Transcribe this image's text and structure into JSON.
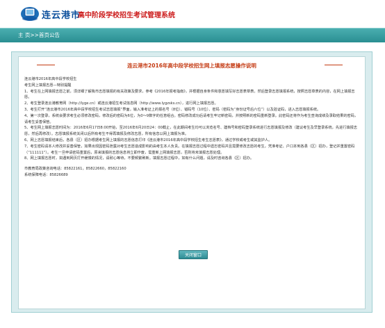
{
  "header": {
    "site_name": "连云港市",
    "system_name": "高中阶段学校招生考试管理系统"
  },
  "breadcrumb": "主 页>>首页公告",
  "notice": {
    "title": "连云港市2016年高中段学校招生网上填报志愿操作说明",
    "intro": [
      "连云港市2016年高中段学校招生",
      "考生网上填报志愿—特别提醒"
    ],
    "items": [
      "1、考生在上网填报志愿之前，须详细了解我市志愿填报的有关政策及要求，参考《2016年报考指南》，并根据自身条件和意愿填写好志愿表草表。然后登录志愿填报系统，按照志愿草表的内容，在网上填报志愿。",
      "2、考生登录连云港教育网（http://lyge.cn）或连云港招生考试信息网（http://www.lygzsks.cn），进行网上填报志愿。",
      "3、考生打开“连云港市2016年高中段学校招生考试志愿填报”界面，输入准考证上的报名号（8位）、错码号（10位）、密码（密码为“身份证号后六位”）以及验证码，进入志愿填报系统。",
      "4、第一次登录，系统会要求考生必须修改密码，修改后的密码为6位，为0～9数字的任意组合。密码修改成功后请考生牢记新密码，并按照新的密码重新登录。此密码还将作为考生查询成绩及录取结果的密码，请考生妥善保管。",
      "5、考生网上填报志愿时间为：2016年6月17日8:00开始，至2016年6月20日24：00截止，在此期间考生均可以浏览名号、建档号和密码登录系统进行志愿填报及修改（建议考生及早登录系统，先进行填报志愿，然后再修改）。志愿填报系统关闭以后所有考生不得再填报及修改志愿，所有信息以网上填报为准。",
      "6、网上志愿填报结束后，各县（区）招办根据考生网上填报的志愿信息打印《连云港市2016年高中段学校招生考生志愿表》，通过学校或考生或其监护人。",
      "7、考生密码请本人修改并妥善保管，如果出现因密码泄露对考生志愿造成影响的由考生本人负责。在填报志愿过程中遗忘密码并且需要修改志愿的考生，凭准考证、户口本到各县（区）招办，登记并重置密码（“111111”）。考生一旦申请密码重置后，原来填报的志愿信息将立即作废，需重新上网填报志愿，否则将未填报志愿处理。",
      "8、网上填报志愿时，如遇到网页打开缓慢的情况，请耐心等待，不要频繁刷新。填报志愿过程中，如有什么问题，请及时咨询各县（区）招办。"
    ],
    "hotline": "市教育局政策咨询电话：85822161，85822660，85822160",
    "maintenance": "系统保障电话：85826689",
    "close_label": "关闭窗口"
  }
}
